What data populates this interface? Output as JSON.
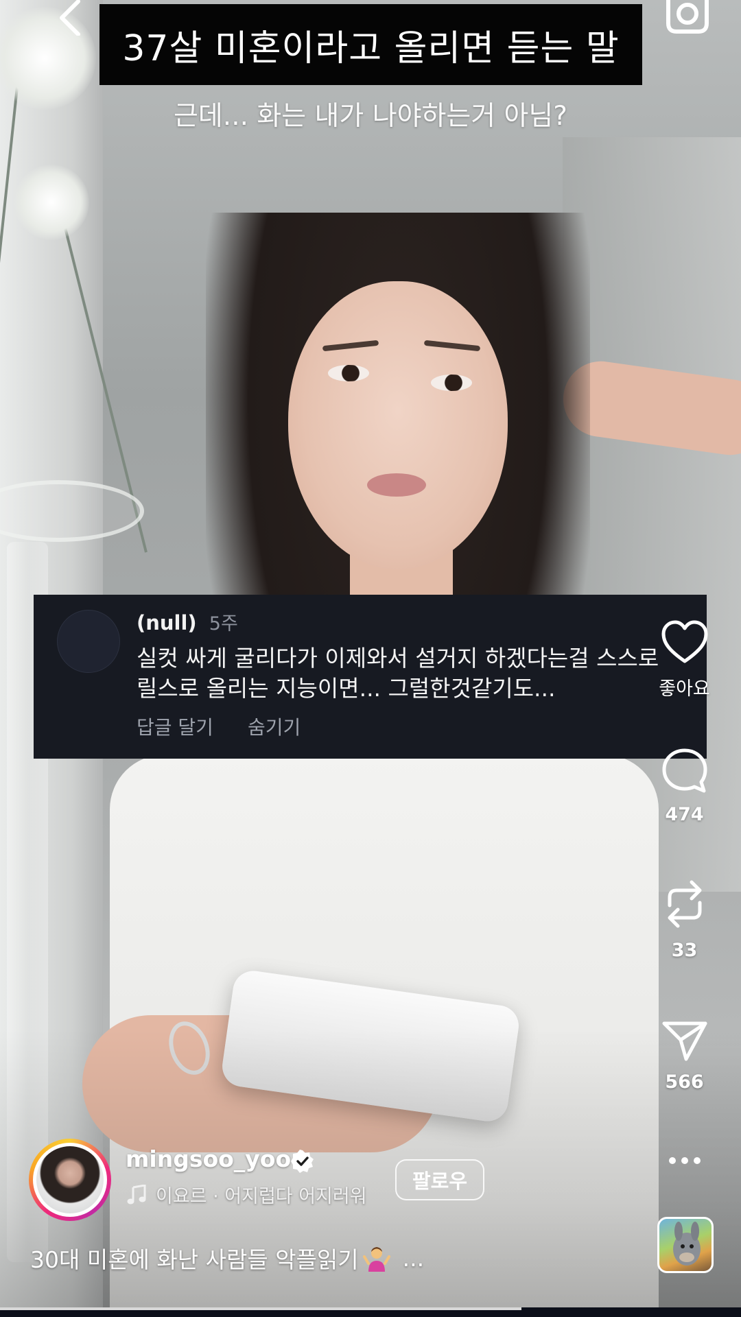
{
  "video": {
    "title_caption": "37살 미혼이라고 올리면 듣는 말",
    "subtitle": "근데... 화는 내가 나야하는거 아님?"
  },
  "comment": {
    "username": "(null)",
    "time": "5주",
    "text_line1": "실컷 싸게 굴리다가 이제와서 설거지 하겠다는걸 스스로",
    "text_line2": "릴스로 올리는 지능이면... 그럴한것같기도...",
    "reply_label": "답글 달기",
    "hide_label": "숨기기"
  },
  "actions": {
    "like_label": "좋아요",
    "comment_count": "474",
    "repost_count": "33",
    "share_count": "566"
  },
  "author": {
    "username": "mingsoo_yoo",
    "follow_label": "팔로우",
    "audio": "이요르 · 어지럽다 어지러워"
  },
  "caption": {
    "text": "30대 미혼에 화난 사람들 악플읽기",
    "more": "..."
  },
  "icons": {
    "back": "chevron-left-icon",
    "camera": "camera-icon",
    "like": "heart-icon",
    "comment": "comment-bubble-icon",
    "repost": "repost-icon",
    "share": "paper-plane-icon",
    "more": "more-dots-icon",
    "verified": "verified-badge-icon",
    "music": "music-note-icon",
    "emoji": "person-shrugging-icon"
  },
  "colors": {
    "comment_card_bg": "#171a22",
    "title_box_bg": "#050505",
    "story_ring": "#ee2a7b"
  }
}
